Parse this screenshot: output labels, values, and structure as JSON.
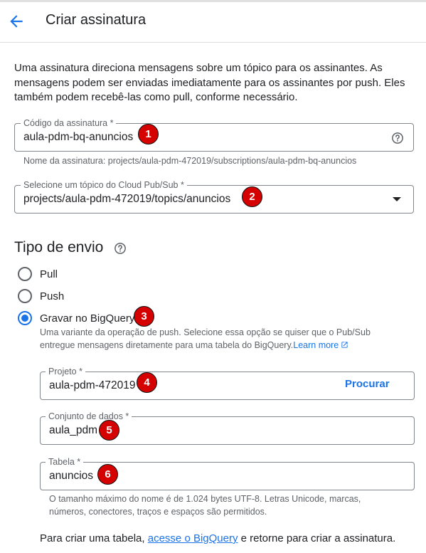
{
  "header": {
    "title": "Criar assinatura",
    "back_icon": "arrow-back-icon"
  },
  "intro": "Uma assinatura direciona mensagens sobre um tópico para os assinantes. As mensagens podem ser enviadas imediatamente para os assinantes por push. Eles também podem recebê-las como pull, conforme necessário.",
  "subscription_id": {
    "label": "Código da assinatura *",
    "value": "aula-pdm-bq-anuncios",
    "helper": "Nome da assinatura: projects/aula-pdm-472019/subscriptions/aula-pdm-bq-anuncios",
    "help_icon": "help-circle-icon"
  },
  "topic": {
    "label": "Selecione um tópico do Cloud Pub/Sub *",
    "value": "projects/aula-pdm-472019/topics/anuncios"
  },
  "delivery": {
    "title": "Tipo de envio",
    "options": [
      {
        "label": "Pull",
        "checked": false
      },
      {
        "label": "Push",
        "checked": false
      },
      {
        "label": "Gravar no BigQuery",
        "checked": true
      }
    ],
    "description": "Uma variante da operação de push. Selecione essa opção se quiser que o Pub/Sub entregue mensagens diretamente para uma tabela do BigQuery.",
    "learn_more": "Learn more"
  },
  "bigquery": {
    "project": {
      "label": "Projeto *",
      "value": "aula-pdm-472019",
      "browse": "Procurar"
    },
    "dataset": {
      "label": "Conjunto de dados *",
      "value": "aula_pdm"
    },
    "table": {
      "label": "Tabela *",
      "value": "anuncios",
      "helper_line1": "O tamanho máximo do nome é de 1.024 bytes UTF-8. Letras Unicode, marcas,",
      "helper_line2": "números, conectores, traços e espaços são permitidos."
    },
    "footer_before": "Para criar uma tabela, ",
    "footer_link": "acesse o BigQuery",
    "footer_after": " e retorne para criar a assinatura."
  },
  "annotations": [
    "1",
    "2",
    "3",
    "4",
    "5",
    "6"
  ],
  "colors": {
    "accent": "#1a73e8",
    "badge": "#d50000"
  }
}
